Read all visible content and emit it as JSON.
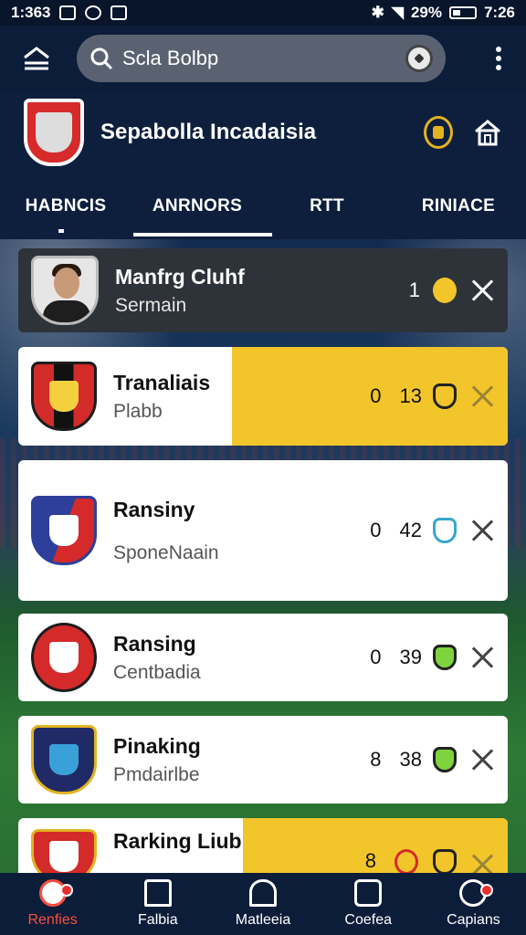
{
  "status_bar": {
    "time_left": "1:363",
    "battery_percent": "29%",
    "time_right": "7:26"
  },
  "search": {
    "value": "Scla Bolbp"
  },
  "header": {
    "title": "Sepabolla Incadaisia"
  },
  "tabs": [
    {
      "label": "HABNCIS"
    },
    {
      "label": "ANRNORS"
    },
    {
      "label": "RTT"
    },
    {
      "label": "RINIACE"
    }
  ],
  "cards": [
    {
      "name": "Manfrg Cluhf",
      "subtitle": "Sermain",
      "score": "1",
      "points": "",
      "theme": "dark"
    },
    {
      "name": "Tranaliais",
      "subtitle": "Plabb",
      "score": "0",
      "points": "13",
      "theme": "yellow"
    },
    {
      "name": "Ransiny",
      "subtitle": "SponeNaain",
      "score": "0",
      "points": "42",
      "theme": "white"
    },
    {
      "name": "Ransing",
      "subtitle": "Centbadia",
      "score": "0",
      "points": "39",
      "theme": "white"
    },
    {
      "name": "Pinaking",
      "subtitle": "Pmdairlbe",
      "score": "8",
      "points": "38",
      "theme": "white"
    },
    {
      "name": "Rarking Liub",
      "subtitle": "",
      "score": "8",
      "points": "",
      "theme": "yellow"
    }
  ],
  "bottom_nav": [
    {
      "label": "Renfies",
      "icon": "soccer-ball-icon",
      "active": true
    },
    {
      "label": "Falbia",
      "icon": "home-icon"
    },
    {
      "label": "Matleeia",
      "icon": "stadium-icon"
    },
    {
      "label": "Coefea",
      "icon": "chart-icon"
    },
    {
      "label": "Capians",
      "icon": "profile-icon"
    }
  ],
  "colors": {
    "accent_yellow": "#f2c52b",
    "nav_active": "#ff4d3d",
    "app_bar": "#0c1d3a"
  }
}
